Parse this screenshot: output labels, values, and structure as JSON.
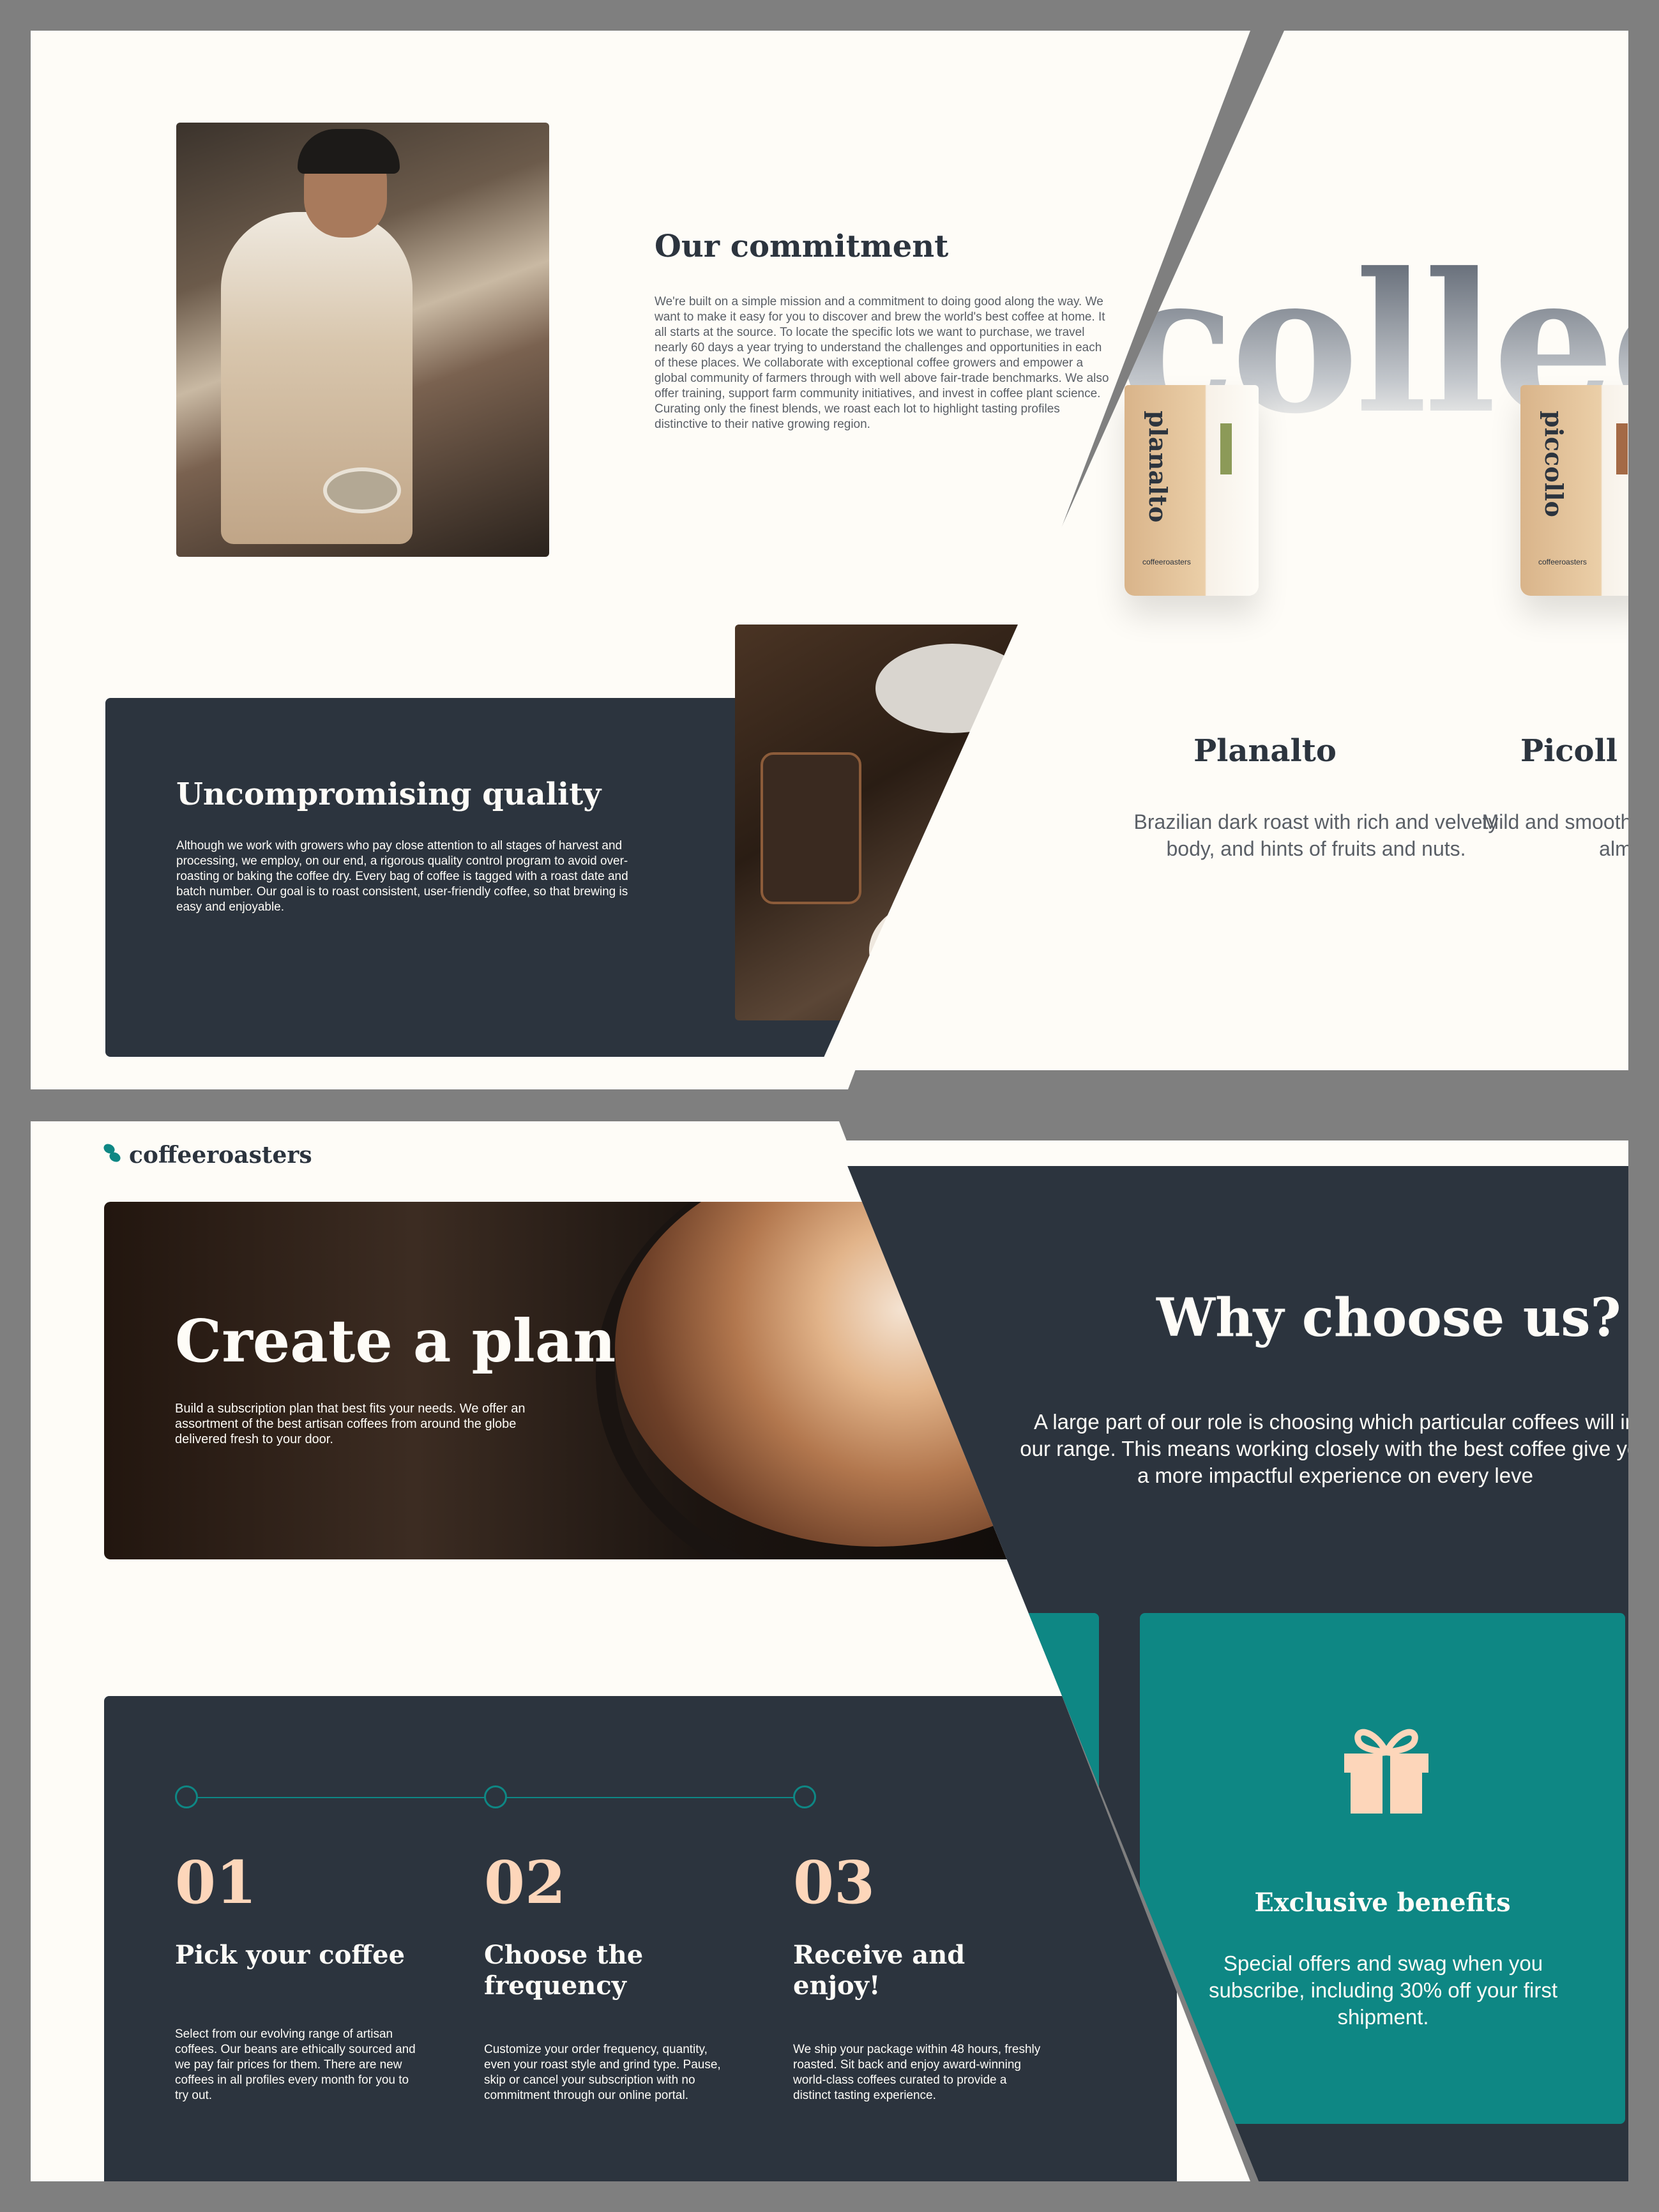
{
  "commitment": {
    "title": "Our commitment",
    "body": "We're built on a simple mission and a commitment to doing good along the way. We want to make it easy for you to discover and brew the world's best coffee at home. It all starts at the source. To locate the specific lots we want to purchase, we travel nearly 60 days a year trying to understand the challenges and opportunities in each of these places. We collaborate with exceptional coffee growers and empower a global community of farmers through with well above fair-trade benchmarks. We also offer training, support farm community initiatives, and invest in coffee plant science. Curating only the finest blends, we roast each lot to highlight tasting profiles distinctive to their native growing region."
  },
  "quality": {
    "title": "Uncompromising quality",
    "body": "Although we work with growers who pay close attention to all stages of harvest and processing, we employ, on our end, a rigorous quality control program to avoid over-roasting or baking the coffee dry. Every bag of coffee is tagged with a roast date and batch number. Our goal is to roast consistent, user-friendly coffee, so that brewing is easy and enjoyable."
  },
  "collection": {
    "heading": "collec",
    "items": [
      {
        "name": "Planalto",
        "bag_label": "planalto",
        "description": "Brazilian dark roast with rich and velvety body, and hints of fruits and nuts."
      },
      {
        "name": "Picoll",
        "bag_label": "piccollo",
        "description": "Mild and smooth blen notes of toasted almo cherry."
      }
    ],
    "bag_logo": "coffeeroasters"
  },
  "brand": {
    "logo_text": "coffeeroasters",
    "accent": "#0e8784",
    "dark": "#2c343e",
    "peach": "#fdd6ba",
    "cream": "#fefcf7"
  },
  "hero": {
    "title": "Create a plan",
    "body": "Build a subscription plan that best fits your needs. We offer an assortment of the best artisan coffees from around the globe delivered fresh to your door."
  },
  "steps": [
    {
      "num": "01",
      "title": "Pick your coffee",
      "body": "Select from our evolving range of artisan coffees. Our beans are ethically sourced and we pay fair prices for them. There are new coffees in all profiles every month for you to try out."
    },
    {
      "num": "02",
      "title": "Choose the frequency",
      "body": "Customize your order frequency, quantity, even your roast style and grind type. Pause, skip or cancel your subscription with no commitment through our online portal."
    },
    {
      "num": "03",
      "title": "Receive and enjoy!",
      "body": "We ship your package within 48 hours, freshly roasted. Sit back and enjoy award-winning world-class coffees curated to provide a distinct tasting experience."
    }
  ],
  "why": {
    "title": "Why choose us?",
    "body": "A large part of our role is choosing which particular coffees will in our range. This means working closely with the best coffee give you a more impactful experience on every leve",
    "benefit": {
      "icon": "gift-icon",
      "title": "Exclusive benefits",
      "body": "Special offers and swag when you subscribe, including 30% off your first shipment."
    }
  }
}
